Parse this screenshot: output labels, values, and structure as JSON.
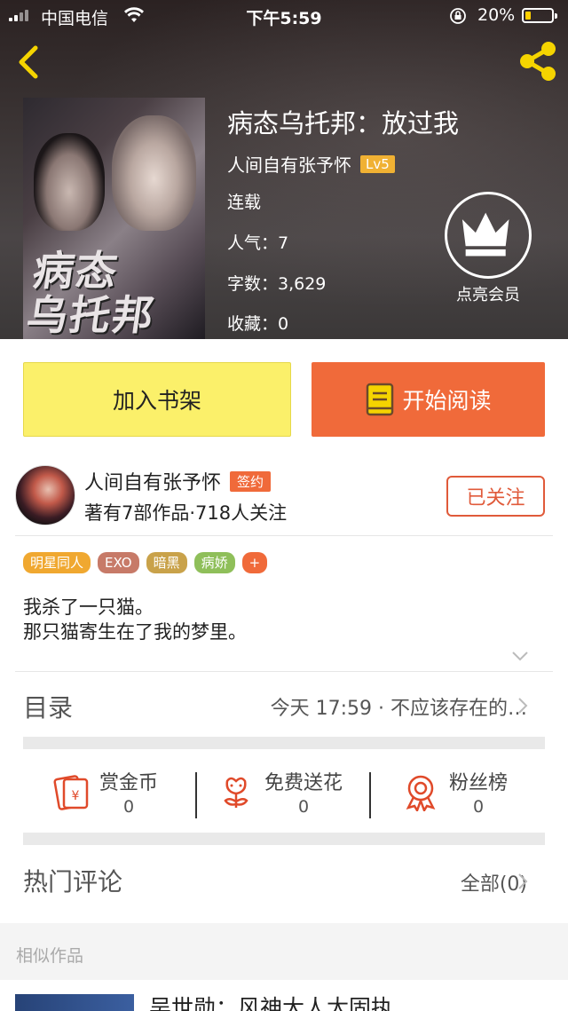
{
  "status_bar": {
    "carrier": "中国电信",
    "time": "下午5:59",
    "battery": "20%"
  },
  "book": {
    "title": "病态乌托邦：放过我",
    "cover_art_text": "病态\n乌托邦",
    "author": "人间自有张予怀",
    "level": "Lv5",
    "status": "连载",
    "popularity": "人气：7",
    "word_count": "字数：3,629",
    "favorites": "收藏：0"
  },
  "vip": {
    "label": "点亮会员"
  },
  "actions": {
    "add_shelf": "加入书架",
    "start_reading": "开始阅读"
  },
  "author_card": {
    "name": "人间自有张予怀",
    "badge": "签约",
    "stats": "著有7部作品·718人关注",
    "follow": "已关注"
  },
  "tags": [
    {
      "label": "明星同人",
      "color": "#f0a830"
    },
    {
      "label": "EXO",
      "color": "#c77a68"
    },
    {
      "label": "暗黑",
      "color": "#c9a24a"
    },
    {
      "label": "病娇",
      "color": "#8fbf5a"
    },
    {
      "label": "+",
      "color": "#f06a3a"
    }
  ],
  "description": {
    "line1": "我杀了一只猫。",
    "line2": "那只猫寄生在了我的梦里。"
  },
  "toc": {
    "label": "目录",
    "latest": "今天 17:59 · 不应该存在的…"
  },
  "stats": [
    {
      "label": "赏金币",
      "value": "0",
      "icon": "red-envelope-icon"
    },
    {
      "label": "免费送花",
      "value": "0",
      "icon": "flower-icon"
    },
    {
      "label": "粉丝榜",
      "value": "0",
      "icon": "medal-icon"
    }
  ],
  "comments": {
    "label": "热门评论",
    "all": "全部(0)"
  },
  "similar": {
    "label": "相似作品",
    "first_title": "吴世勋：风神大人太固执"
  },
  "colors": {
    "accent_orange": "#f06a3a",
    "shelf_yellow": "#fbf06a",
    "icon_red": "#e04a2a"
  }
}
